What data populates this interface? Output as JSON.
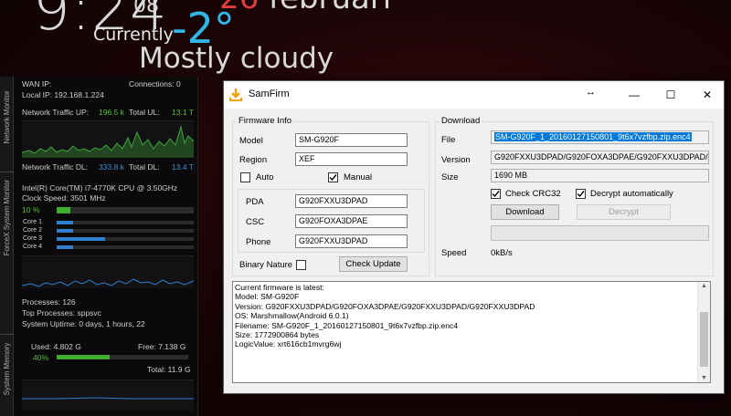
{
  "weather": {
    "time": "9:24",
    "seconds": "08",
    "currently_label": "Currently",
    "temperature": "-2°",
    "date_day": "26",
    "date_month": "februari",
    "condition": "Mostly cloudy"
  },
  "monitor": {
    "sidebar_labels": [
      "Network Monitor",
      "ForceX System Monitor",
      "System Memory"
    ],
    "wan_ip_label": "WAN IP:",
    "connections_label": "Connections:",
    "connections_value": "0",
    "local_ip": "Local IP: 192.168.1.224",
    "traffic_up_label": "Network Traffic UP:",
    "traffic_up_value": "196.5 k",
    "total_ul_label": "Total UL:",
    "total_ul_value": "13.1 T",
    "traffic_dl_label": "Network Traffic DL:",
    "traffic_dl_value": "333.8 k",
    "total_dl_label": "Total DL:",
    "total_dl_value": "13.4 T",
    "cpu_name": "Intel(R) Core(TM) i7-4770K CPU @ 3.50GHz",
    "clock_speed": "Clock Speed: 3501 MHz",
    "cpu_usage_text": "10 %",
    "cpu_usage_fraction": 0.1,
    "cores": [
      {
        "label": "Core 1",
        "load": 0.12
      },
      {
        "label": "Core 2",
        "load": 0.12
      },
      {
        "label": "Core 3",
        "load": 0.35
      },
      {
        "label": "Core 4",
        "load": 0.12
      }
    ],
    "processes": "Processes: 126",
    "top_processes": "Top Processes: sppsvc",
    "uptime": "System Uptime: 0 days, 1 hours, 22",
    "mem_used": "Used: 4.802 G",
    "mem_free": "Free: 7.138 G",
    "mem_percent": "40%",
    "mem_fraction": 0.4,
    "mem_total": "Total: 11.9 G"
  },
  "window": {
    "title": "SamFirm",
    "resize_icon": "↔",
    "minimize": "—",
    "maximize": "☐",
    "close": "✕",
    "firmware_info": {
      "group_title": "Firmware Info",
      "model_label": "Model",
      "model_value": "SM-G920F",
      "region_label": "Region",
      "region_value": "XEF",
      "auto_label": "Auto",
      "auto_checked": false,
      "manual_label": "Manual",
      "manual_checked": true,
      "pda_label": "PDA",
      "pda_value": "G920FXXU3DPAD",
      "csc_label": "CSC",
      "csc_value": "G920FOXA3DPAE",
      "phone_label": "Phone",
      "phone_value": "G920FXXU3DPAD",
      "binary_nature_label": "Binary Nature",
      "binary_nature_checked": false,
      "check_update_label": "Check Update"
    },
    "download": {
      "group_title": "Download",
      "file_label": "File",
      "file_value": "SM-G920F_1_20160127150801_9t6x7vzfbp.zip.enc4",
      "version_label": "Version",
      "version_value": "G920FXXU3DPAD/G920FOXA3DPAE/G920FXXU3DPAD/",
      "size_label": "Size",
      "size_value": "1690 MB",
      "check_crc_label": "Check CRC32",
      "check_crc_checked": true,
      "decrypt_auto_label": "Decrypt automatically",
      "decrypt_auto_checked": true,
      "download_button": "Download",
      "decrypt_button": "Decrypt",
      "progress": 0,
      "speed_label": "Speed",
      "speed_value": "0kB/s"
    },
    "log_lines": [
      "Current firmware is latest:",
      "Model: SM-G920F",
      "Version: G920FXXU3DPAD/G920FOXA3DPAE/G920FXXU3DPAD/G920FXXU3DPAD",
      "OS: Marshmallow(Android 6.0.1)",
      "Filename: SM-G920F_1_20160127150801_9t6x7vzfbp.zip.enc4",
      "Size: 1772900864 bytes",
      "LogicValue: xrt616cb1mvrg6wj"
    ]
  }
}
